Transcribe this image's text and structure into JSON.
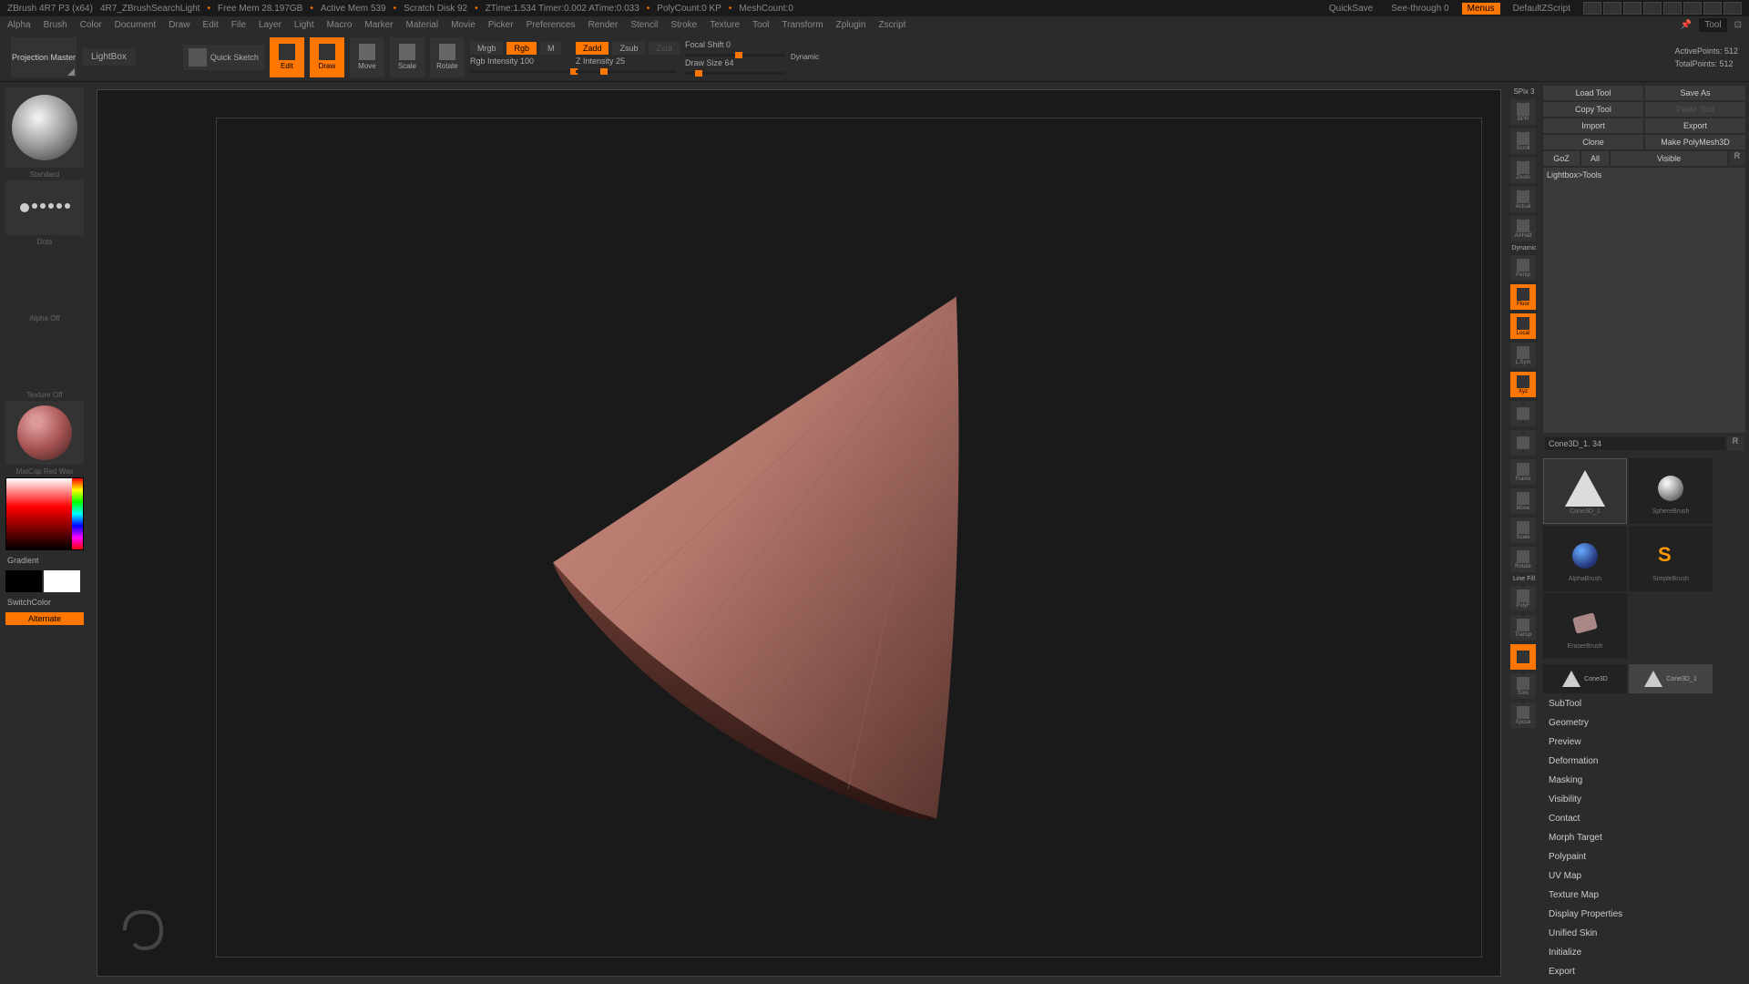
{
  "title": {
    "app": "ZBrush 4R7 P3 (x64)",
    "doc": "4R7_ZBrushSearchLight",
    "free_mem": "Free Mem 28.197GB",
    "active_mem": "Active Mem 539",
    "scratch": "Scratch Disk 92",
    "ztime": "ZTime:1.534 Timer:0.002 ATime:0.033",
    "polycount": "PolyCount:0 KP",
    "meshcount": "MeshCount:0",
    "quicksave": "QuickSave",
    "seethrough": "See-through   0",
    "menus": "Menus",
    "script": "DefaultZScript"
  },
  "menu": {
    "items": [
      "Alpha",
      "Brush",
      "Color",
      "Document",
      "Draw",
      "Edit",
      "File",
      "Layer",
      "Light",
      "Macro",
      "Marker",
      "Material",
      "Movie",
      "Picker",
      "Preferences",
      "Render",
      "Stencil",
      "Stroke",
      "Texture",
      "Tool",
      "Transform",
      "Zplugin",
      "Zscript"
    ],
    "right_label": "Tool"
  },
  "shelf": {
    "proj_master": "Projection Master",
    "lightbox": "LightBox",
    "quick": "Quick Sketch",
    "modes": [
      "Edit",
      "Draw",
      "Move",
      "Scale",
      "Rotate"
    ],
    "mrgb": "Mrgb",
    "rgb": "Rgb",
    "m": "M",
    "rgb_int": "Rgb Intensity 100",
    "zadd": "Zadd",
    "zsub": "Zsub",
    "zcut": "Zcut",
    "z_int": "Z Intensity 25",
    "focal": "Focal Shift 0",
    "draw_size": "Draw Size 64",
    "dynamic": "Dynamic",
    "active_pts": "ActivePoints: 512",
    "total_pts": "TotalPoints: 512"
  },
  "left": {
    "brush": "Standard",
    "stroke": "Dots",
    "alpha": "Alpha Off",
    "texture": "Texture Off",
    "material": "MatCap Red Wax",
    "gradient": "Gradient",
    "switch": "SwitchColor",
    "alternate": "Alternate"
  },
  "rstrip": {
    "items": [
      "BPR",
      "Scroll",
      "Zoom",
      "Actual",
      "AAHalf",
      "Persp",
      "Floor",
      "Local",
      "L.Sym",
      "",
      "",
      "Frame",
      "Move",
      "Scale",
      "Rotate",
      "PolyF",
      "Transp",
      "",
      "Solo",
      "Xpose"
    ],
    "spix": "SPix 3",
    "dynamic": "Dynamic",
    "linefill": "Line Fill"
  },
  "tool": {
    "load": "Load Tool",
    "save": "Save As",
    "copy": "Copy Tool",
    "paste": "Paste Tool",
    "import": "Import",
    "export": "Export",
    "clone": "Clone",
    "poly3d": "Make PolyMesh3D",
    "goz": "GoZ",
    "all": "All",
    "visible": "Visible",
    "r": "R",
    "lightbox_tools": "Lightbox>Tools",
    "current": "Cone3D_1. 34",
    "brushes": [
      "Cone3D_1",
      "SphereBrush",
      "AlphaBrush",
      "SimpleBrush",
      "EraserBrush"
    ],
    "small": [
      "Cone3D",
      "Cone3D_1"
    ],
    "sections": [
      "SubTool",
      "Geometry",
      "Preview",
      "Deformation",
      "Masking",
      "Visibility",
      "Contact",
      "Morph Target",
      "Polypaint",
      "UV Map",
      "Texture Map",
      "Display Properties",
      "Unified Skin",
      "Initialize",
      "Export"
    ]
  }
}
